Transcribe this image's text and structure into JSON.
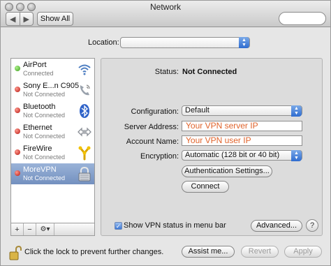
{
  "window": {
    "title": "Network"
  },
  "toolbar": {
    "back": "◀",
    "forward": "▶",
    "show_all": "Show All"
  },
  "location": {
    "label": "Location:",
    "value": ""
  },
  "services": [
    {
      "name": "AirPort",
      "status": "Connected",
      "state": "green",
      "icon": "wifi-icon"
    },
    {
      "name": "Sony E...n C905",
      "status": "Not Connected",
      "state": "red",
      "icon": "phone-icon"
    },
    {
      "name": "Bluetooth",
      "status": "Not Connected",
      "state": "red",
      "icon": "bluetooth-icon"
    },
    {
      "name": "Ethernet",
      "status": "Not Connected",
      "state": "red",
      "icon": "ethernet-icon"
    },
    {
      "name": "FireWire",
      "status": "Not Connected",
      "state": "red",
      "icon": "firewire-icon"
    },
    {
      "name": "MoreVPN",
      "status": "Not Connected",
      "state": "red",
      "icon": "vpn-lock-icon",
      "selected": true
    }
  ],
  "sidebar_footer": {
    "add": "+",
    "remove": "−",
    "action": "⚙▾"
  },
  "detail": {
    "status_label": "Status:",
    "status_value": "Not Connected",
    "configuration_label": "Configuration:",
    "configuration_value": "Default",
    "server_label": "Server Address:",
    "server_value": "Your VPN server IP",
    "account_label": "Account Name:",
    "account_value": "Your VPN user IP",
    "encryption_label": "Encryption:",
    "encryption_value": "Automatic (128 bit or 40 bit)",
    "auth_button": "Authentication Settings...",
    "connect_button": "Connect",
    "show_vpn_label": "Show VPN status in menu bar",
    "show_vpn_checked": true,
    "advanced_button": "Advanced...",
    "help": "?"
  },
  "bottom": {
    "lock_text": "Click the lock to prevent further changes.",
    "assist_button": "Assist me...",
    "revert_button": "Revert",
    "apply_button": "Apply"
  },
  "colors": {
    "accent": "#3d78d4",
    "field_text": "#e0632b",
    "selection": "#7f9ac6"
  }
}
